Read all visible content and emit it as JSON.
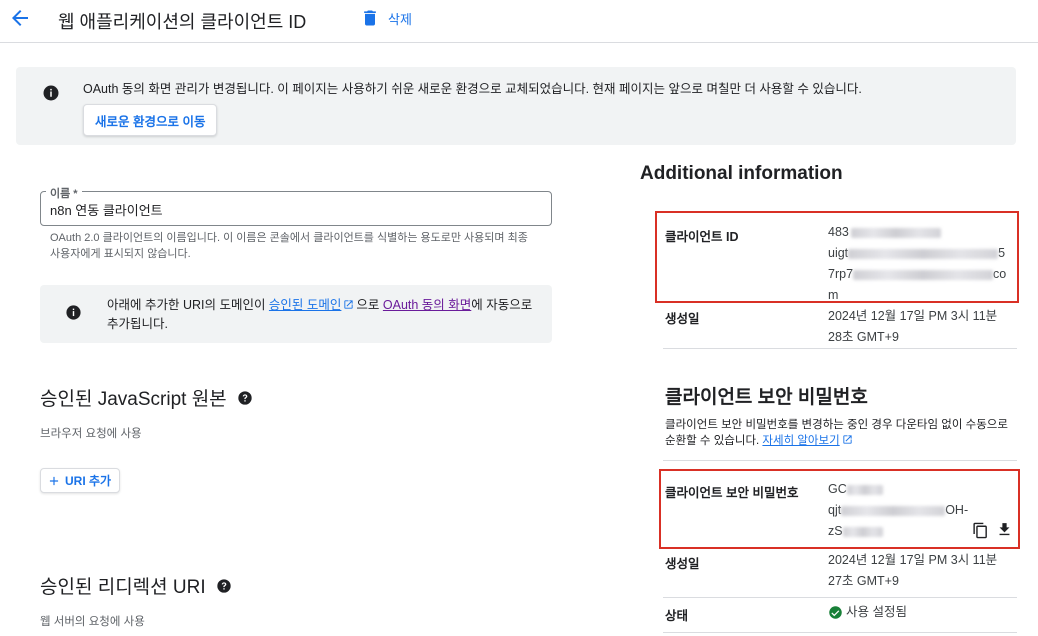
{
  "header": {
    "title": "웹 애플리케이션의 클라이언트 ID",
    "delete_label": "삭제"
  },
  "banner": {
    "text": "OAuth 동의 화면 관리가 변경됩니다. 이 페이지는 사용하기 쉬운 새로운 환경으로 교체되었습니다. 현재 페이지는 앞으로 며칠만 더 사용할 수 있습니다.",
    "button_label": "새로운 환경으로 이동"
  },
  "name_field": {
    "label": "이름 *",
    "value": "n8n 연동 클라이언트",
    "helper": "OAuth 2.0 클라이언트의 이름입니다. 이 이름은 콘솔에서 클라이언트를 식별하는 용도로만 사용되며 최종 사용자에게 표시되지 않습니다."
  },
  "uri_info": {
    "text_before": "아래에 추가한 URI의 도메인이 ",
    "link1": "승인된 도메인",
    "text_middle": "으로 ",
    "link2": "OAuth 동의 화면",
    "text_after": "에 자동으로 추가됩니다."
  },
  "js_origins": {
    "title": "승인된 JavaScript 원본",
    "subtitle": "브라우저 요청에 사용",
    "add_label": "URI 추가"
  },
  "redirect_uris": {
    "title": "승인된 리디렉션 URI",
    "subtitle": "웹 서버의 요청에 사용"
  },
  "additional": {
    "title": "Additional information",
    "client_id_label": "클라이언트 ID",
    "client_id_line1": "483",
    "client_id_line2_start": "uigt",
    "client_id_line2_end": "5",
    "client_id_line3_start": "7rp7",
    "client_id_line3_end": "co",
    "client_id_line4": "m",
    "created_label": "생성일",
    "created_value_1": "2024년 12월 17일 PM 3시 11분 28초 GMT+9"
  },
  "secret": {
    "title": "클라이언트 보안 비밀번호",
    "desc": "클라이언트 보안 비밀번호를 변경하는 중인 경우 다운타임 없이 수동으로 순환할 수 있습니다. ",
    "learn_more": "자세히 알아보기",
    "secret_label": "클라이언트 보안 비밀번호",
    "secret_line1": "GC",
    "secret_line2_start": "qjt",
    "secret_line2_end": "OH-",
    "secret_line3": "zS",
    "created_label": "생성일",
    "created_value_2": "2024년 12월 17일 PM 3시 11분 27초 GMT+9",
    "status_label": "상태",
    "status_value": "사용 설정됨"
  },
  "colors": {
    "accent": "#1a73e8",
    "highlight": "#d93025",
    "status_ok": "#188038"
  }
}
